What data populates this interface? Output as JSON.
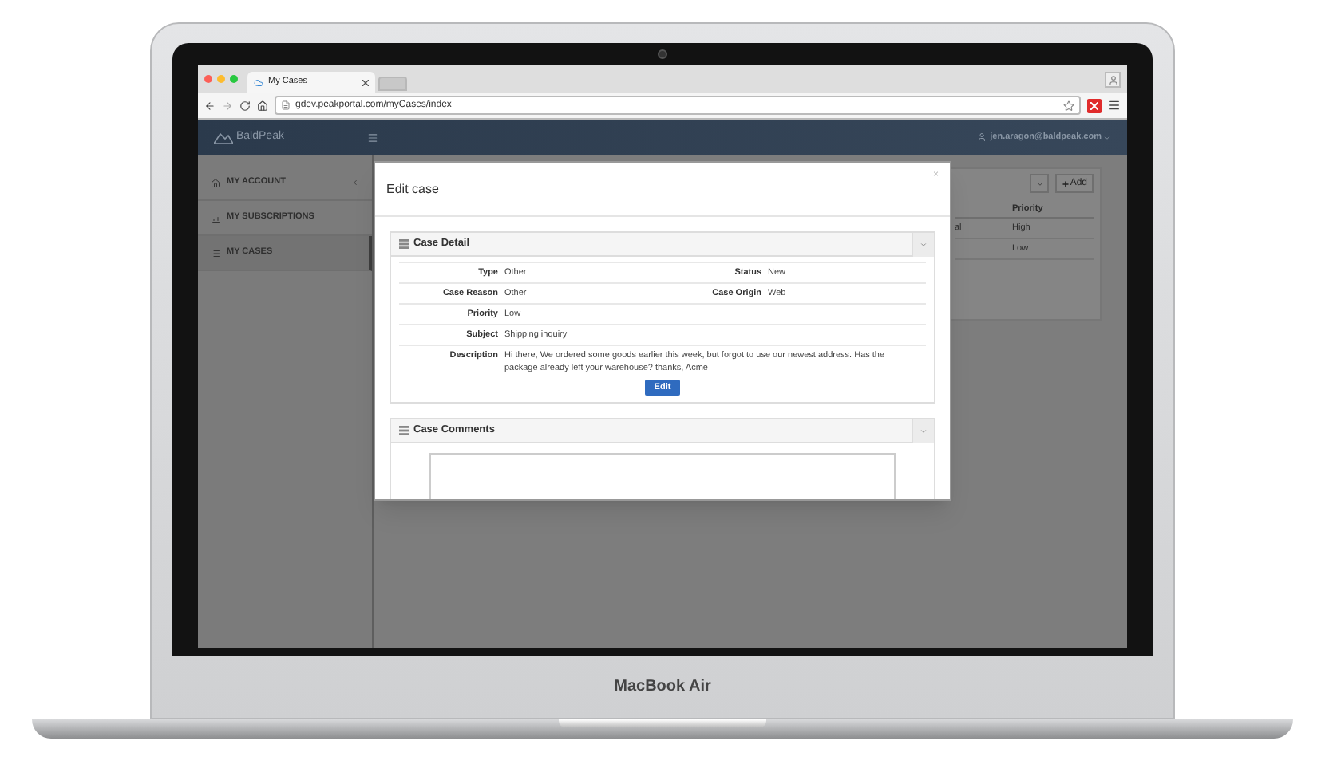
{
  "browser": {
    "tabs": [
      {
        "title": "My Cases",
        "selected": true
      }
    ],
    "url": "gdev.peakportal.com/myCases/index"
  },
  "app": {
    "brand": "BaldPeak",
    "user": "jen.aragon@baldpeak.com"
  },
  "sidebar": {
    "items": [
      {
        "label": "MY ACCOUNT",
        "expandable": true,
        "selected": false
      },
      {
        "label": "MY SUBSCRIPTIONS",
        "expandable": false,
        "selected": false
      },
      {
        "label": "MY CASES",
        "expandable": false,
        "selected": true
      }
    ]
  },
  "background_table": {
    "add_button": "Add",
    "columns": [
      "Priority"
    ],
    "rows": [
      {
        "column_1": "al",
        "priority": "High"
      },
      {
        "priority": "Low"
      }
    ]
  },
  "modal": {
    "title": "Edit case",
    "close": "×",
    "sections": [
      {
        "title": "Case Detail",
        "expanded": true,
        "button": "Edit",
        "rows": [
          [
            {
              "label": "Type",
              "value": "Other"
            },
            {
              "label": "Status",
              "value": "New"
            }
          ],
          [
            {
              "label": "Case Reason",
              "value": "Other"
            },
            {
              "label": "Case Origin",
              "value": "Web"
            }
          ],
          [
            {
              "label": "Priority",
              "value": "Low"
            }
          ],
          [
            {
              "label": "Subject",
              "value": "Shipping inquiry"
            }
          ],
          [
            {
              "label": "Description",
              "value": "Hi there, We ordered some goods earlier this week, but forgot to use our newest address. Has the package already left your warehouse? thanks, Acme"
            }
          ]
        ]
      },
      {
        "title": "Case Comments",
        "expanded": true
      }
    ]
  },
  "device": {
    "label": "MacBook Air"
  }
}
